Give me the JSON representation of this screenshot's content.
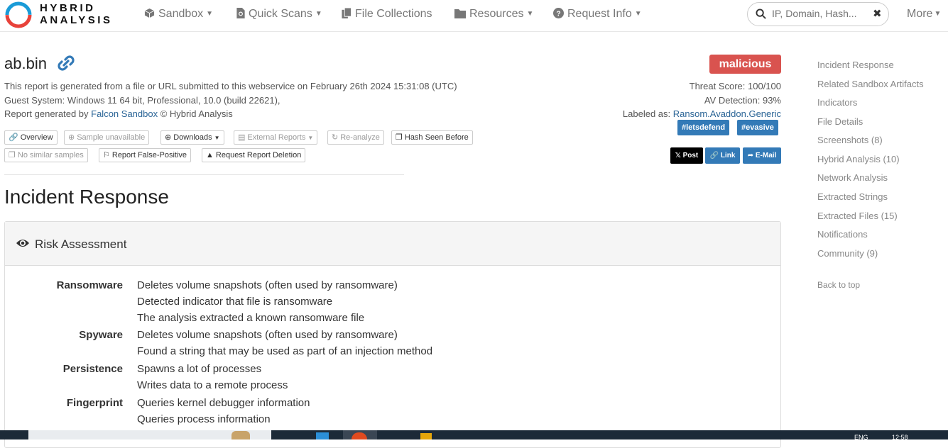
{
  "nav": {
    "logo_line1": "HYBRID",
    "logo_line2": "ANALYSIS",
    "items": [
      {
        "label": "Sandbox",
        "icon": "cube-icon"
      },
      {
        "label": "Quick Scans",
        "icon": "file-scan-icon"
      },
      {
        "label": "File Collections",
        "icon": "files-icon"
      },
      {
        "label": "Resources",
        "icon": "folder-icon"
      },
      {
        "label": "Request Info",
        "icon": "question-circle-icon"
      }
    ],
    "search_placeholder": "IP, Domain, Hash...",
    "more_label": "More"
  },
  "report": {
    "title": "ab.bin",
    "submitted_line": "This report is generated from a file or URL submitted to this webservice on February 26th 2024 15:31:08 (UTC)",
    "guest_system": "Guest System: Windows 11 64 bit, Professional, 10.0 (build 22621),",
    "generated_prefix": "Report generated by ",
    "generated_link": "Falcon Sandbox",
    "generated_suffix": " © Hybrid Analysis"
  },
  "actions": {
    "row1": [
      "Overview",
      "Sample unavailable",
      "Downloads",
      "External Reports",
      "Re-analyze",
      "Hash Seen Before"
    ],
    "row2": [
      "No similar samples",
      "Report False-Positive",
      "Request Report Deletion"
    ]
  },
  "verdict": {
    "label": "malicious",
    "threat_score": "Threat Score: 100/100",
    "av_detection": "AV Detection: 93%",
    "labeled_prefix": "Labeled as: ",
    "labeled_value": "Ransom.Avaddon.Generic",
    "tags": [
      "#letsdefend",
      "#evasive"
    ],
    "share": {
      "post": "Post",
      "link": "Link",
      "email": "E-Mail"
    },
    "colors": {
      "malicious": "#d9534f",
      "tag": "#337ab7",
      "post": "#000000"
    }
  },
  "section": {
    "title": "Incident Response",
    "panel_title": "Risk Assessment",
    "risks": [
      {
        "category": "Ransomware",
        "items": [
          "Deletes volume snapshots (often used by ransomware)",
          "Detected indicator that file is ransomware",
          "The analysis extracted a known ransomware file"
        ]
      },
      {
        "category": "Spyware",
        "items": [
          "Deletes volume snapshots (often used by ransomware)",
          "Found a string that may be used as part of an injection method"
        ]
      },
      {
        "category": "Persistence",
        "items": [
          "Spawns a lot of processes",
          "Writes data to a remote process"
        ]
      },
      {
        "category": "Fingerprint",
        "items": [
          "Queries kernel debugger information",
          "Queries process information"
        ]
      }
    ]
  },
  "sidebar": {
    "items": [
      "Incident Response",
      "Related Sandbox Artifacts",
      "Indicators",
      "File Details",
      "Screenshots (8)",
      "Hybrid Analysis (10)",
      "Network Analysis",
      "Extracted Strings",
      "Extracted Files (15)",
      "Notifications",
      "Community (9)"
    ],
    "back_to_top": "Back to top"
  },
  "taskbar": {
    "lang": "ENG",
    "time": "12:58"
  }
}
